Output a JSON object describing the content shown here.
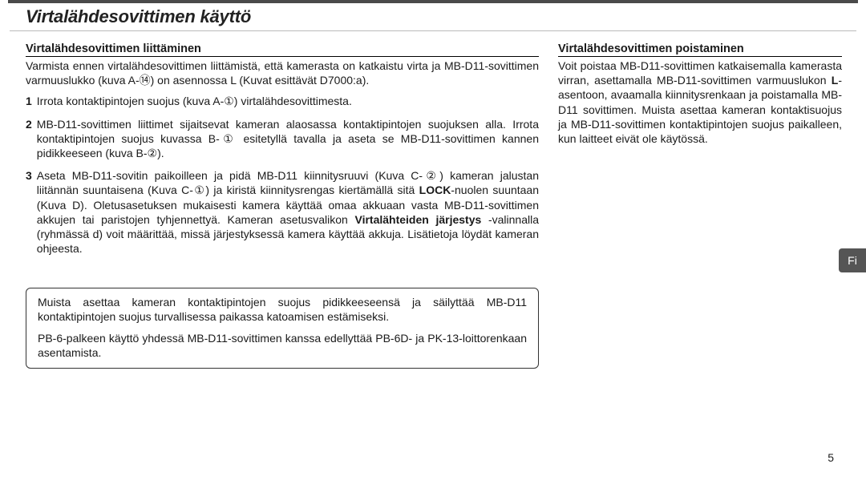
{
  "page": {
    "title": "Virtalähdesovittimen käyttö",
    "number": "5",
    "lang_tab": "Fi"
  },
  "left": {
    "heading": "Virtalähdesovittimen liittäminen",
    "intro": "Varmista ennen virtalähdesovittimen liittämistä, että kamerasta on katkaistu virta ja MB-D11-sovittimen varmuuslukko (kuva A-⑭) on asennossa L (Kuvat esittävät D7000:a).",
    "items": [
      {
        "num": "1",
        "text": "Irrota kontaktipintojen suojus (kuva A-①) virtalähdesovittimesta."
      },
      {
        "num": "2",
        "text": "MB-D11-sovittimen liittimet sijaitsevat kameran alaosassa kontaktipintojen suojuksen alla. Irrota kontaktipintojen suojus kuvassa B-① esitetyllä tavalla ja aseta se MB-D11-sovittimen kannen pidikkeeseen (kuva B-②)."
      },
      {
        "num": "3",
        "pre": "Aseta MB-D11-sovitin paikoilleen ja pidä MB-D11 kiinnitysruuvi (Kuva C-②) kameran jalustan liitännän suuntaisena (Kuva C-①) ja kiristä kiinnitysrengas kiertämällä sitä ",
        "bold1": "LOCK",
        "mid": "-nuolen suuntaan (Kuva D). Oletusasetuksen mukaisesti kamera käyttää omaa akkuaan vasta MB-D11-sovittimen akkujen tai paristojen tyhjennettyä. Kameran asetusvalikon ",
        "bold2": "Virtalähteiden järjestys",
        "post": " -valinnalla (ryhmässä d) voit määrittää, missä järjestyksessä kamera käyttää akkuja. Lisätietoja löydät kameran ohjeesta."
      }
    ],
    "notice": {
      "p1": "Muista asettaa kameran kontaktipintojen suojus pidikkeeseensä ja säilyttää MB-D11 kontaktipintojen suojus turvallisessa paikassa katoamisen estämiseksi.",
      "p2": "PB-6-palkeen käyttö yhdessä MB-D11-sovittimen kanssa edellyttää PB-6D- ja PK-13-loittorenkaan asentamista."
    }
  },
  "right": {
    "heading": "Virtalähdesovittimen poistaminen",
    "para_pre": "Voit poistaa MB-D11-sovittimen katkaisemalla kamerasta virran, asettamalla MB-D11-sovittimen varmuuslukon ",
    "para_bold": "L",
    "para_post": "-asentoon, avaamalla kiinnitysrenkaan ja poistamalla MB-D11 sovittimen. Muista asettaa kameran kontaktisuojus ja MB-D11-sovittimen kontaktipintojen suojus paikalleen, kun laitteet eivät ole käytössä."
  }
}
